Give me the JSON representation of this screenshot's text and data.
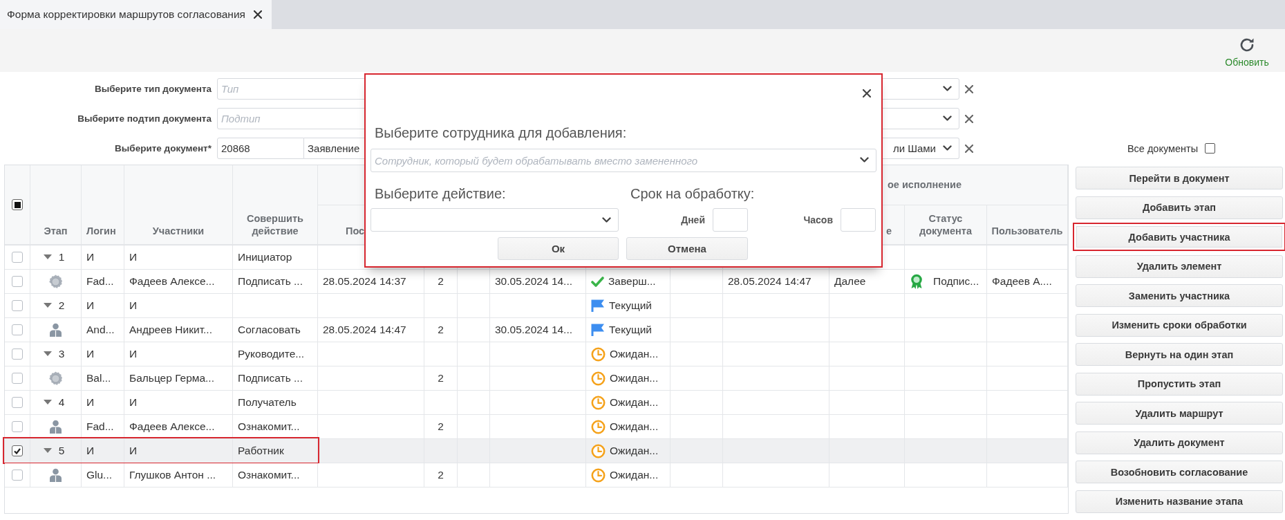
{
  "tabs": [
    {
      "label": "Форма корректировки маршрутов согласования",
      "selected": true
    }
  ],
  "toolbar": {
    "refresh_label": "Обновить"
  },
  "filters": [
    {
      "label": "Выберите тип документа",
      "placeholder": "Тип"
    },
    {
      "label": "Выберите подтип документа",
      "placeholder": "Подтип"
    },
    {
      "label": "Выберите документ*",
      "number": "20868",
      "value_start": "Заявление",
      "value_end": "ли Шами"
    }
  ],
  "all_documents": {
    "label": "Все документы",
    "checked": false
  },
  "table": {
    "select_all_indeterminate": true,
    "columns": [
      "Этап",
      "Логин",
      "Участники",
      "Совершить действие",
      "Пос",
      "е",
      "Статус документа",
      "Пользователь"
    ],
    "group_header": "ое исполнение",
    "rows": [
      {
        "kind": "stage",
        "checked": false,
        "selected": false,
        "highlighted": false,
        "expanded": true,
        "stage": "1",
        "login": "И",
        "participant": "И",
        "action": "Инициатор"
      },
      {
        "kind": "signer",
        "checked": false,
        "selected": false,
        "highlighted": false,
        "login": "Fad...",
        "participant": "Фадеев Алексе...",
        "action": "Подписать ...",
        "start": "28.05.2024 14:37",
        "count": "2",
        "deadline": "30.05.2024 14...",
        "status": {
          "kind": "done",
          "text": "Заверш..."
        },
        "finished": "28.05.2024 14:47",
        "decision": "Далее",
        "doc_status": {
          "kind": "signed",
          "text": "Подпис..."
        },
        "user": "Фадеев А...."
      },
      {
        "kind": "stage",
        "checked": false,
        "selected": false,
        "highlighted": false,
        "expanded": true,
        "stage": "2",
        "login": "И",
        "participant": "И",
        "status": {
          "kind": "current",
          "text": "Текущий"
        }
      },
      {
        "kind": "person",
        "checked": false,
        "selected": false,
        "highlighted": false,
        "login": "And...",
        "participant": "Андреев Никит...",
        "action": "Согласовать",
        "start": "28.05.2024 14:47",
        "count": "2",
        "deadline": "30.05.2024 14...",
        "status": {
          "kind": "current",
          "text": "Текущий"
        }
      },
      {
        "kind": "stage",
        "checked": false,
        "selected": false,
        "highlighted": false,
        "expanded": true,
        "stage": "3",
        "login": "И",
        "participant": "И",
        "action": "Руководите...",
        "status": {
          "kind": "waiting",
          "text": "Ожидан..."
        }
      },
      {
        "kind": "signer",
        "checked": false,
        "selected": false,
        "highlighted": false,
        "login": "Bal...",
        "participant": "Бальцер Герма...",
        "action": "Подписать ...",
        "count": "2",
        "status": {
          "kind": "waiting",
          "text": "Ожидан..."
        }
      },
      {
        "kind": "stage",
        "checked": false,
        "selected": false,
        "highlighted": false,
        "expanded": true,
        "stage": "4",
        "login": "И",
        "participant": "И",
        "action": "Получатель",
        "status": {
          "kind": "waiting",
          "text": "Ожидан..."
        }
      },
      {
        "kind": "person",
        "checked": false,
        "selected": false,
        "highlighted": false,
        "login": "Fad...",
        "participant": "Фадеев Алексе...",
        "action": "Ознакомит...",
        "count": "2",
        "status": {
          "kind": "waiting",
          "text": "Ожидан..."
        }
      },
      {
        "kind": "stage",
        "checked": true,
        "selected": true,
        "highlighted": true,
        "expanded": true,
        "stage": "5",
        "login": "И",
        "participant": "И",
        "action": "Работник",
        "status": {
          "kind": "waiting",
          "text": "Ожидан..."
        }
      },
      {
        "kind": "person",
        "checked": false,
        "selected": false,
        "highlighted": false,
        "login": "Glu...",
        "participant": "Глушков Антон ...",
        "action": "Ознакомит...",
        "count": "2",
        "status": {
          "kind": "waiting",
          "text": "Ожидан..."
        }
      }
    ]
  },
  "actions": [
    {
      "label": "Перейти в документ",
      "highlighted": false
    },
    {
      "label": "Добавить этап",
      "highlighted": false
    },
    {
      "label": "Добавить участника",
      "highlighted": true
    },
    {
      "label": "Удалить элемент",
      "highlighted": false
    },
    {
      "label": "Заменить участника",
      "highlighted": false
    },
    {
      "label": "Изменить сроки обработки",
      "highlighted": false
    },
    {
      "label": "Вернуть на один этап",
      "highlighted": false
    },
    {
      "label": "Пропустить этап",
      "highlighted": false
    },
    {
      "label": "Удалить маршрут",
      "highlighted": false
    },
    {
      "label": "Удалить документ",
      "highlighted": false
    },
    {
      "label": "Возобновить согласование",
      "highlighted": false
    },
    {
      "label": "Изменить название этапа",
      "highlighted": false
    }
  ],
  "dialog": {
    "highlighted": true,
    "employee_label": "Выберите сотрудника для добавления:",
    "employee_placeholder": "Сотрудник, который будет обрабатывать вместо замененного",
    "action_label": "Выберите действие:",
    "term_label": "Срок на обработку:",
    "days_label": "Дней",
    "hours_label": "Часов",
    "ok": "Ок",
    "cancel": "Отмена"
  }
}
